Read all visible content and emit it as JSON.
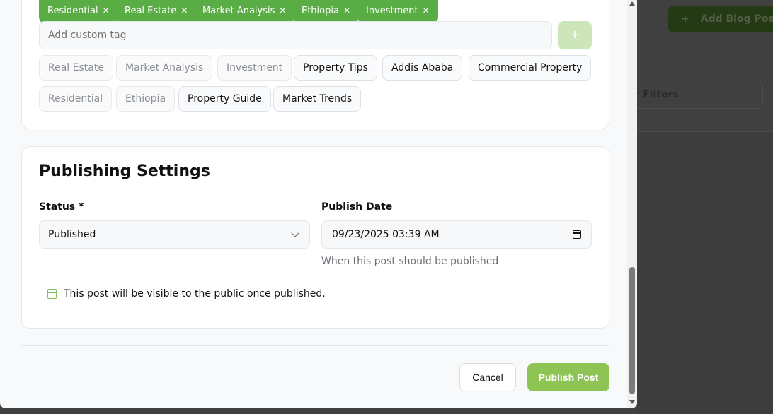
{
  "background": {
    "add_blog_post_label": "Add Blog Post",
    "filters_label": "ar Filters"
  },
  "tags": {
    "selected": [
      "Residential",
      "Real Estate",
      "Market Analysis",
      "Ethiopia",
      "Investment"
    ],
    "remove_glyph": "✕",
    "custom_tag_placeholder": "Add custom tag",
    "add_glyph": "+",
    "suggestions": [
      {
        "label": "Real Estate",
        "state": "used"
      },
      {
        "label": "Market Analysis",
        "state": "used"
      },
      {
        "label": "Investment",
        "state": "used"
      },
      {
        "label": "Property Tips",
        "state": "available"
      },
      {
        "label": "Addis Ababa",
        "state": "available"
      },
      {
        "label": "Commercial Property",
        "state": "available"
      },
      {
        "label": "Residential",
        "state": "used"
      },
      {
        "label": "Ethiopia",
        "state": "used"
      },
      {
        "label": "Property Guide",
        "state": "available"
      },
      {
        "label": "Market Trends",
        "state": "available"
      }
    ]
  },
  "publishing": {
    "title": "Publishing Settings",
    "status_label": "Status *",
    "status_value": "Published",
    "publish_date_label": "Publish Date",
    "publish_date_value": "09/23/2025 03:39 AM",
    "publish_date_helper": "When this post should be published",
    "notice": "This post will be visible to the public once published."
  },
  "footer": {
    "cancel_label": "Cancel",
    "publish_label": "Publish Post"
  },
  "colors": {
    "accent": "#5aad45",
    "publish_button": "#8dc454",
    "add_tag_button": "#cde6b9"
  }
}
